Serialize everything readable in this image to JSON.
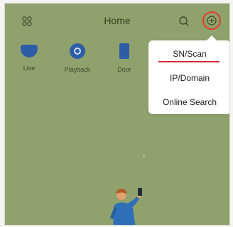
{
  "header": {
    "title": "Home",
    "menu_icon": "grid-icon",
    "search_icon": "search-icon",
    "add_icon": "add-circle-icon",
    "highlight_color": "#e43a2f"
  },
  "features": [
    {
      "label": "Live",
      "icon": "camera-icon"
    },
    {
      "label": "Playback",
      "icon": "playback-icon"
    },
    {
      "label": "Door",
      "icon": "door-icon"
    }
  ],
  "add_menu": {
    "items": [
      {
        "label": "SN/Scan",
        "underlined": true
      },
      {
        "label": "IP/Domain"
      },
      {
        "label": "Online Search"
      }
    ],
    "underline_color": "#d9282f"
  },
  "illustration": "person-with-phone-illustration"
}
